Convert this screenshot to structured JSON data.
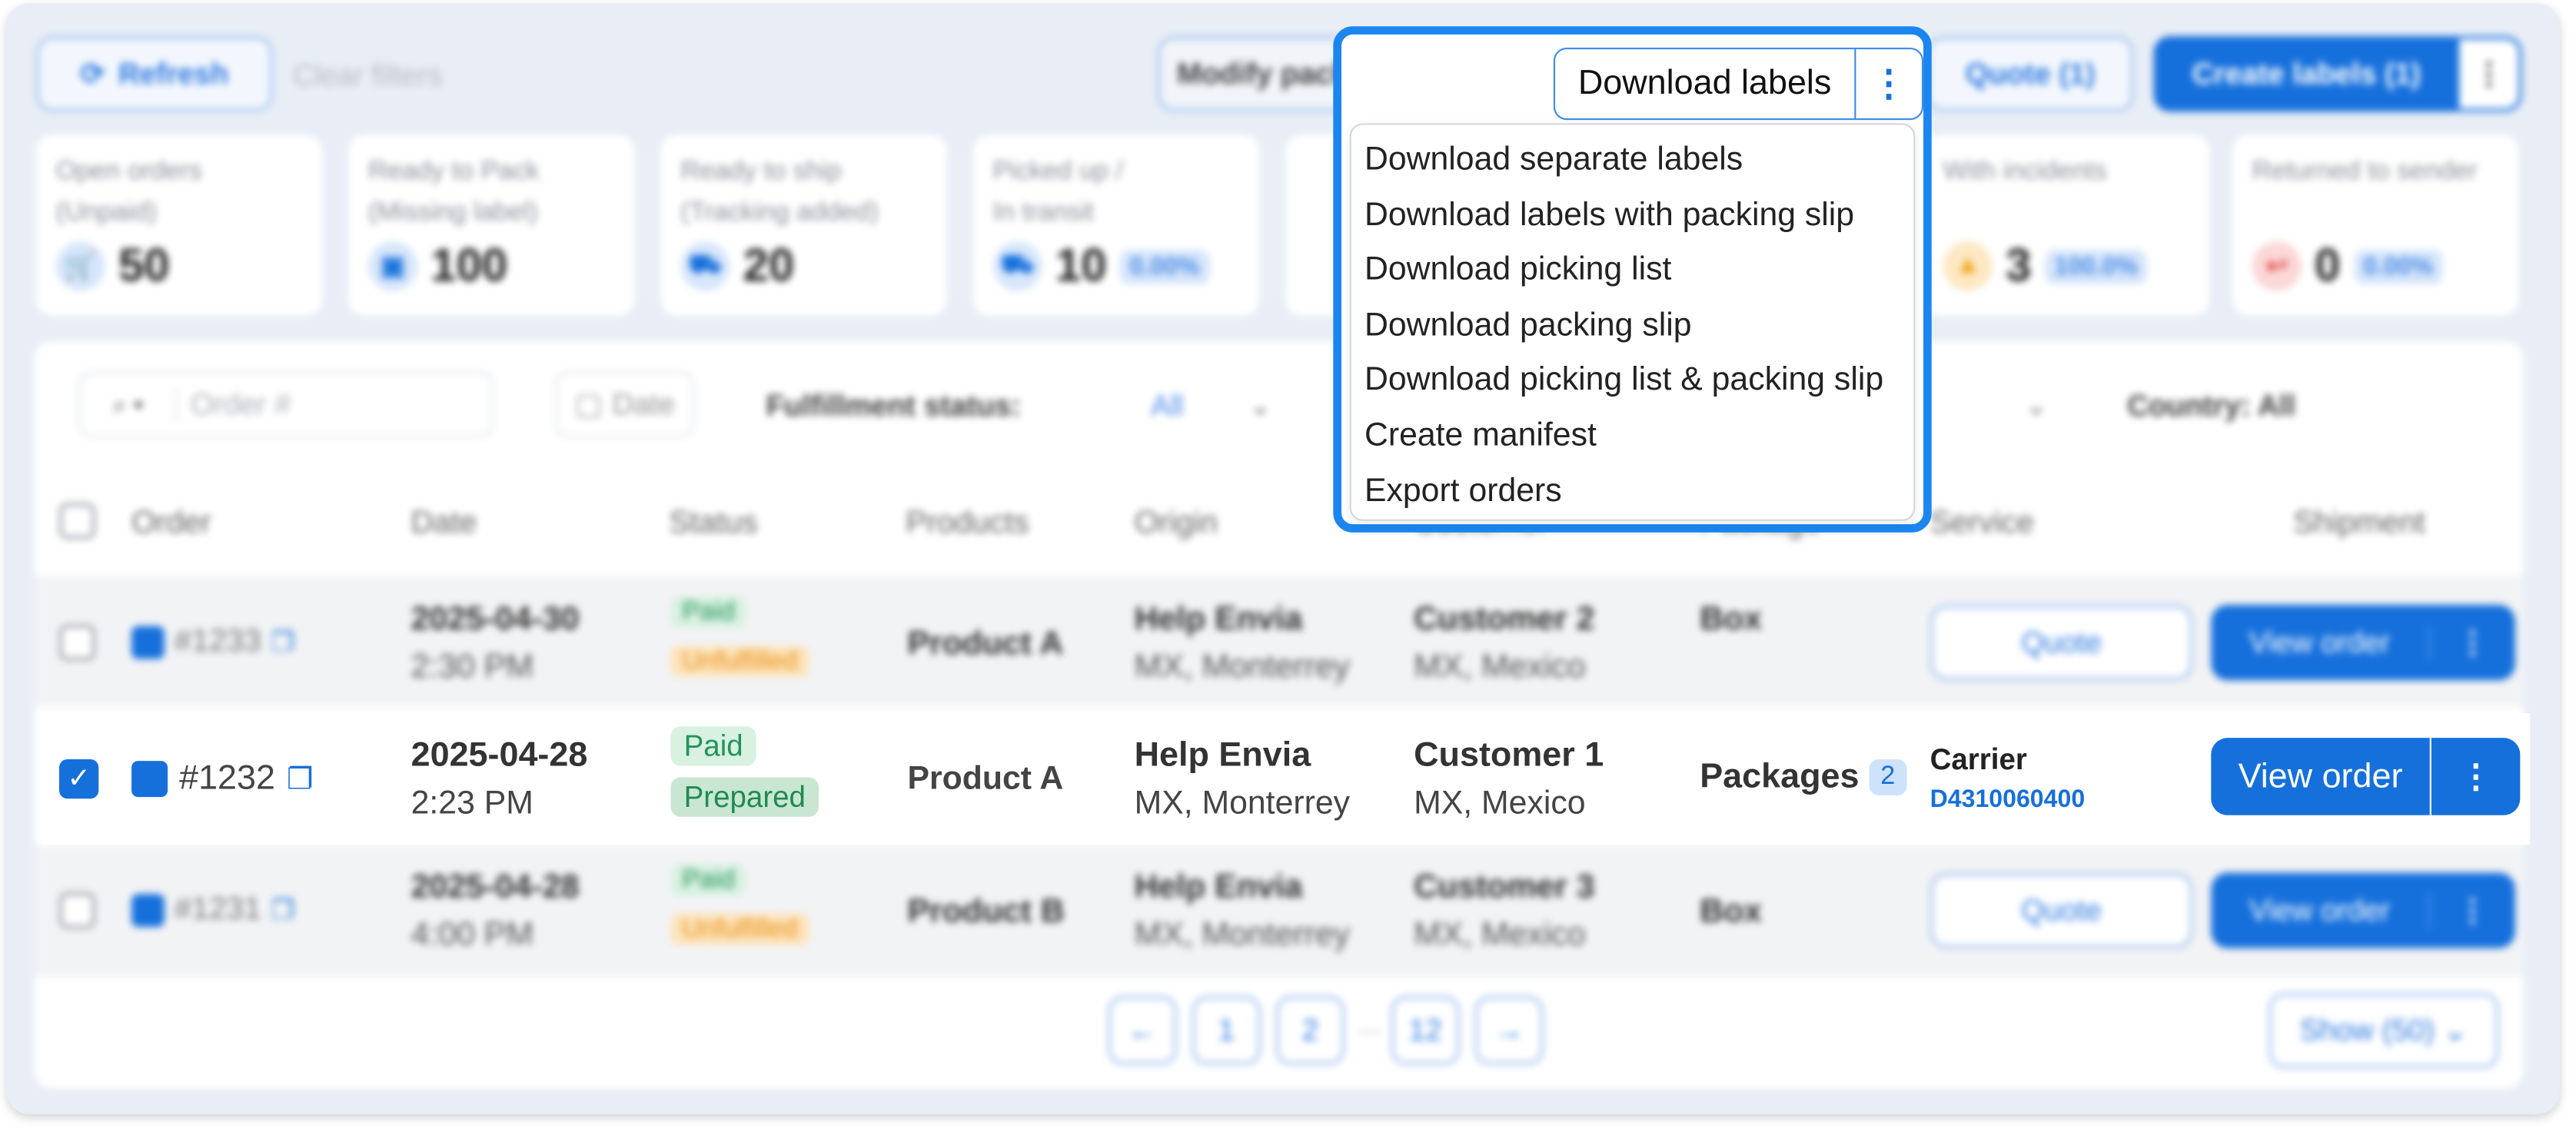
{
  "toolbar": {
    "refresh_label": "Refresh",
    "clear_filters_label": "Clear filters",
    "modify_package_label": "Modify package",
    "download_labels_label": "Download labels",
    "quote_label": "Quote (1)",
    "create_labels_label": "Create labels (1)"
  },
  "stats": [
    {
      "label": "Open orders\n(Unpaid)",
      "value": "50",
      "pct": ""
    },
    {
      "label": "Ready to Pack\n(Missing label)",
      "value": "100",
      "pct": ""
    },
    {
      "label": "Ready to ship\n(Tracking added)",
      "value": "20",
      "pct": ""
    },
    {
      "label": "Picked up /\nIn transit",
      "value": "10",
      "pct": "0.00%"
    },
    {
      "label": "With incidents",
      "value": "3",
      "pct": "100.0%"
    },
    {
      "label": "Returned to sender",
      "value": "0",
      "pct": "0.00%"
    }
  ],
  "filters": {
    "order_placeholder": "Order #",
    "date_label": "Date",
    "fulfillment_label": "Fulfillment status:",
    "fulfillment_value": "All",
    "country_label": "Country: All"
  },
  "table": {
    "headers": [
      "Order",
      "Date",
      "Status",
      "Products",
      "Origin",
      "Customer",
      "Package",
      "Service",
      "Shipment"
    ],
    "rows": [
      {
        "order": "#1233",
        "date": "2025-04-30",
        "time": "2:30 PM",
        "status1": "Paid",
        "status2": "Unfulfilled",
        "product": "Product A",
        "origin": "Help Envia",
        "origin_sub": "MX, Monterrey",
        "customer": "Customer 2",
        "customer_sub": "MX, Mexico",
        "package": "Box",
        "service": "Quote",
        "view": "View order"
      },
      {
        "order": "#1232",
        "date": "2025-04-28",
        "time": "2:23 PM",
        "status1": "Paid",
        "status2": "Prepared",
        "product": "Product A",
        "origin": "Help Envia",
        "origin_sub": "MX, Monterrey",
        "customer": "Customer 1",
        "customer_sub": "MX, Mexico",
        "package": "Packages",
        "package_count": "2",
        "carrier": "Carrier",
        "tracking": "D4310060400",
        "view": "View order"
      },
      {
        "order": "#1231",
        "date": "2025-04-28",
        "time": "4:00 PM",
        "status1": "Paid",
        "status2": "Unfulfilled",
        "product": "Product B",
        "origin": "Help Envia",
        "origin_sub": "MX, Monterrey",
        "customer": "Customer 3",
        "customer_sub": "MX, Mexico",
        "package": "Box",
        "service": "Quote",
        "view": "View order"
      }
    ]
  },
  "pagination": {
    "pages": [
      "1",
      "2",
      "12"
    ],
    "ellipsis": "...",
    "show_label": "Show (50)"
  },
  "dropdown": {
    "items": [
      "Download separate labels",
      "Download labels with packing slip",
      "Download picking list",
      "Download packing slip",
      "Download picking list & packing slip",
      "Create manifest",
      "Export orders"
    ]
  },
  "colors": {
    "accent": "#1670dc",
    "highlight": "#1b86ef",
    "paid": "#22945a",
    "unfulfilled": "#e8931d"
  }
}
